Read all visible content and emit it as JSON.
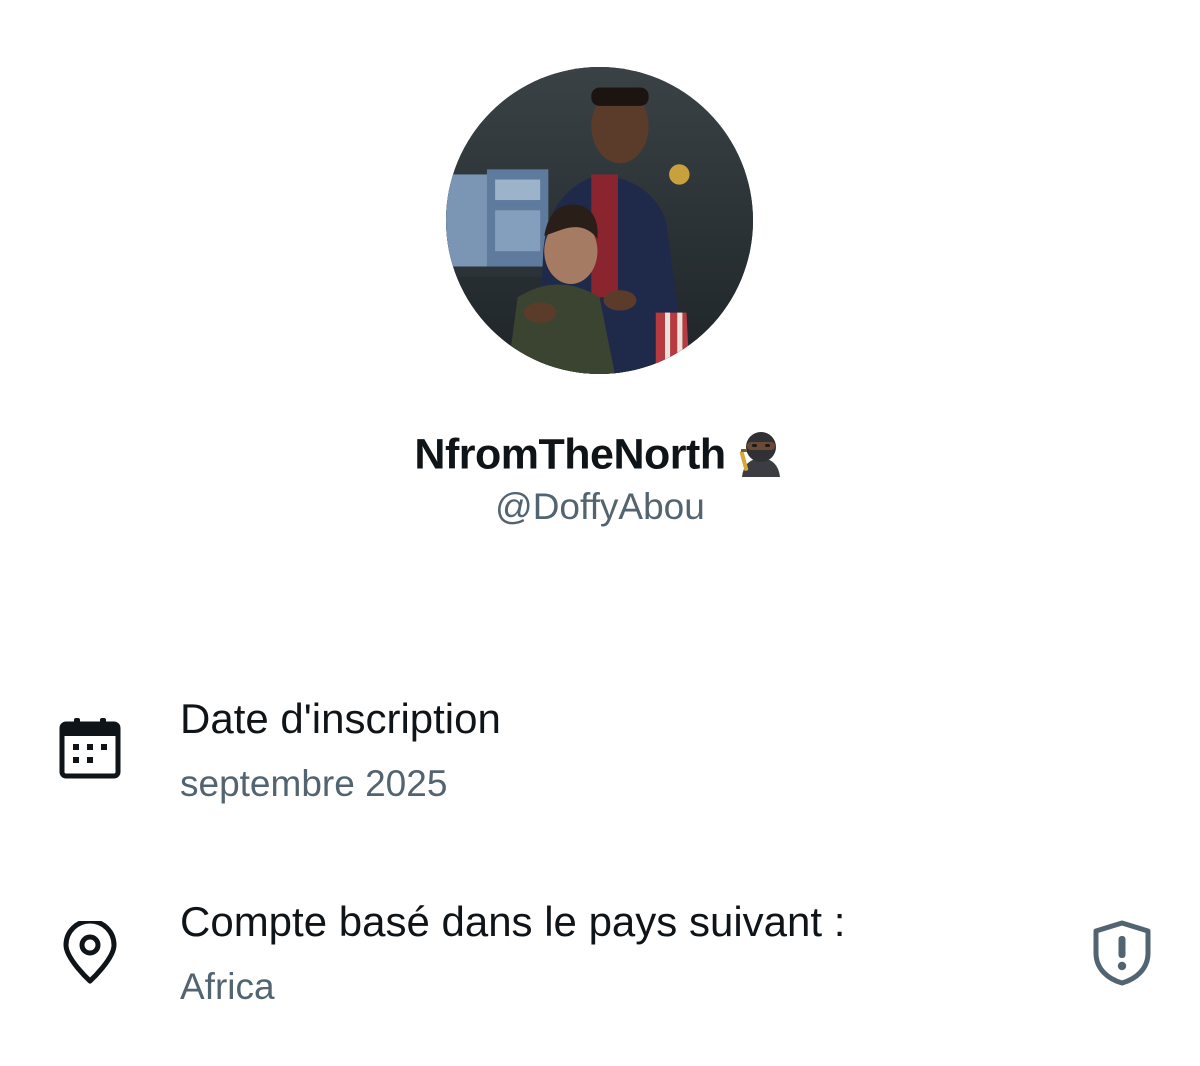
{
  "profile": {
    "display_name": "NfromTheNorth",
    "name_emoji": "ninja-emoji-dark-skin",
    "handle": "@DoffyAbou",
    "avatar": "profile-photo"
  },
  "details": {
    "joined": {
      "icon": "calendar-icon",
      "title": "Date d'inscription",
      "value": "septembre 2025"
    },
    "location": {
      "icon": "location-pin-icon",
      "title": "Compte basé dans le pays suivant :",
      "value": "Africa",
      "badge_icon": "shield-alert-icon"
    }
  },
  "colors": {
    "text_primary": "#0f1419",
    "text_secondary": "#536471"
  }
}
